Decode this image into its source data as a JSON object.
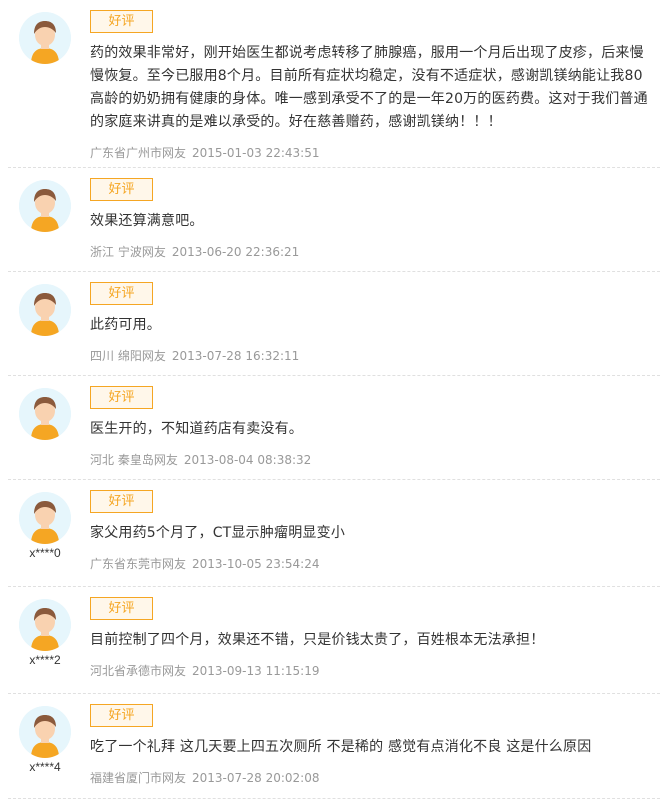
{
  "badge_label": "好评",
  "reviews": [
    {
      "user": "",
      "text": "药的效果非常好，刚开始医生都说考虑转移了肺腺癌，服用一个月后出现了皮疹，后来慢慢恢复。至今已服用8个月。目前所有症状均稳定，没有不适症状，感谢凯镁纳能让我80高龄的奶奶拥有健康的身体。唯一感到承受不了的是一年20万的医药费。这对于我们普通的家庭来讲真的是难以承受的。好在慈善赠药，感谢凯镁纳！！！",
      "location": "广东省广州市网友",
      "time": "2015-01-03 22:43:51"
    },
    {
      "user": "",
      "text": "效果还算满意吧。",
      "location": "浙江 宁波网友",
      "time": "2013-06-20 22:36:21"
    },
    {
      "user": "",
      "text": "此药可用。",
      "location": "四川 绵阳网友",
      "time": "2013-07-28 16:32:11"
    },
    {
      "user": "",
      "text": "医生开的，不知道药店有卖没有。",
      "location": "河北 秦皇岛网友",
      "time": "2013-08-04 08:38:32"
    },
    {
      "user": "x****0",
      "text": "家父用药5个月了，CT显示肿瘤明显变小",
      "location": "广东省东莞市网友",
      "time": "2013-10-05 23:54:24"
    },
    {
      "user": "x****2",
      "text": "目前控制了四个月，效果还不错，只是价钱太贵了，百姓根本无法承担！",
      "location": "河北省承德市网友",
      "time": "2013-09-13 11:15:19"
    },
    {
      "user": "x****4",
      "text": "吃了一个礼拜 这几天要上四五次厕所 不是稀的 感觉有点消化不良 这是什么原因",
      "location": "福建省厦门市网友",
      "time": "2013-07-28 20:02:08"
    }
  ],
  "colors": {
    "badge": "#f5a623",
    "badge_bg": "#fff7ea",
    "meta": "#999999",
    "avatar_bg": "#e6f6fc"
  }
}
